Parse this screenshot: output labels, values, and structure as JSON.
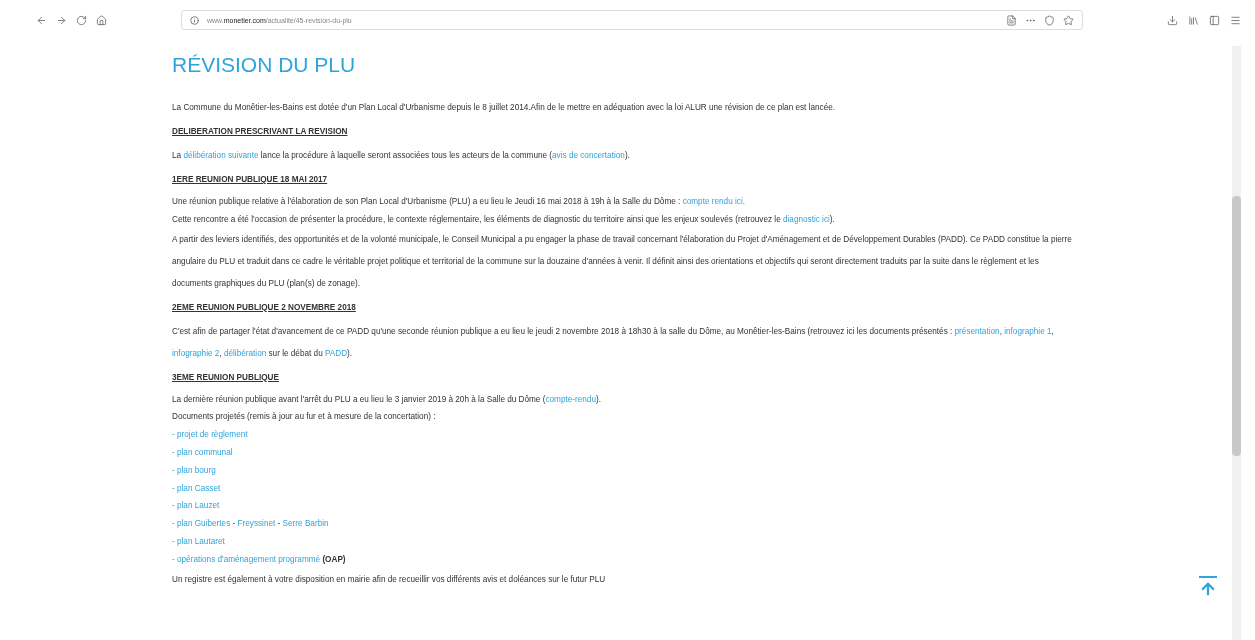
{
  "browser": {
    "url": "www.**monetier.com**/actualite/45-revision-du-plu"
  },
  "page": {
    "title": "RÉVISION DU PLU",
    "blocks": [
      {
        "kind": "paragraph",
        "segments": [
          {
            "text": "La Commune du Monêtier-les-Bains est dotée d'un Plan Local d'Urbanisme depuis le 8 juillet 2014.Afin de le mettre en adéquation avec la loi ALUR une révision de ce plan est lancée."
          }
        ]
      },
      {
        "kind": "heading",
        "segments": [
          {
            "text": "DELIBERATION PRESCRIVANT LA REVISION"
          }
        ]
      },
      {
        "kind": "paragraph",
        "segments": [
          {
            "text": " La "
          },
          {
            "link": "délibération suivante"
          },
          {
            "text": " lance la procédure à laquelle seront associées tous les acteurs de la commune ("
          },
          {
            "link": "avis de concertation"
          },
          {
            "text": ")."
          }
        ]
      },
      {
        "kind": "heading",
        "segments": [
          {
            "text": "1ERE REUNION PUBLIQUE 18 MAI 2017"
          }
        ]
      },
      {
        "kind": "line",
        "segments": [
          {
            "text": "Une réunion publique relative à l'élaboration de son Plan Local d'Urbanisme (PLU) a eu lieu le Jeudi 16 mai 2018 à 19h à la Salle du Dôme : "
          },
          {
            "link": "compte rendu ici."
          }
        ]
      },
      {
        "kind": "line",
        "segments": [
          {
            "text": "Cette rencontre a été l'occasion de présenter la procédure, le contexte réglementaire, les éléments de diagnostic du territoire ainsi que les enjeux soulevés (retrouvez le "
          },
          {
            "link": "diagnostic ici"
          },
          {
            "text": ")."
          }
        ]
      },
      {
        "kind": "paragraph",
        "segments": [
          {
            "text": "A partir des leviers identifiés, des opportunités et de la volonté municipale, le Conseil Municipal a pu engager la phase de travail concernant l'élaboration du Projet d'Aménagement et de Développement Durables (PADD). Ce PADD constitue la pierre angulaire du PLU et traduit dans ce cadre le véritable projet politique et territorial de la commune sur la douzaine d'années à venir. Il définit ainsi des orientations et objectifs qui seront directement traduits par la suite dans le règlement et les documents graphiques du PLU (plan(s) de zonage)."
          }
        ]
      },
      {
        "kind": "heading",
        "segments": [
          {
            "text": "2EME REUNION PUBLIQUE 2 NOVEMBRE 2018"
          }
        ]
      },
      {
        "kind": "paragraph",
        "segments": [
          {
            "text": "C'est afin de partager l'état d'avancement de ce PADD qu'une seconde réunion publique a eu lieu le jeudi 2 novembre 2018 à 18h30 à la salle du Dôme, au Monêtier-les-Bains (retrouvez ici les documents présentés : "
          },
          {
            "link": "présentation"
          },
          {
            "text": ", "
          },
          {
            "link": "infographie 1"
          },
          {
            "text": ", "
          },
          {
            "link": "infographie 2"
          },
          {
            "text": ", "
          },
          {
            "link": "délibération"
          },
          {
            "text": " sur le débat du "
          },
          {
            "link": "PADD"
          },
          {
            "text": ")."
          }
        ]
      },
      {
        "kind": "heading",
        "segments": [
          {
            "text": "3EME REUNION PUBLIQUE"
          }
        ]
      },
      {
        "kind": "line",
        "segments": [
          {
            "text": "La dernière réunion publique avant l'arrêt du PLU a eu lieu le 3 janvier 2019 à 20h à la Salle du Dôme ("
          },
          {
            "link": "compte-rendu"
          },
          {
            "text": ")."
          }
        ]
      },
      {
        "kind": "line",
        "segments": [
          {
            "text": "Documents projetés (remis à jour au fur et à mesure de la concertation) :"
          }
        ]
      },
      {
        "kind": "line",
        "segments": [
          {
            "link": "- projet de règlement"
          }
        ]
      },
      {
        "kind": "line",
        "segments": [
          {
            "link": "- plan communal"
          }
        ]
      },
      {
        "kind": "line",
        "segments": [
          {
            "link": "- plan bourg"
          }
        ]
      },
      {
        "kind": "line",
        "segments": [
          {
            "link": "- plan Casset"
          }
        ]
      },
      {
        "kind": "line",
        "segments": [
          {
            "link": "- plan Lauzet"
          }
        ]
      },
      {
        "kind": "line",
        "segments": [
          {
            "link": "- plan Guibertes"
          },
          {
            "text": " - "
          },
          {
            "link": "Freyssinet"
          },
          {
            "text": " - "
          },
          {
            "link": "Serre Barbin"
          }
        ]
      },
      {
        "kind": "line",
        "segments": [
          {
            "link": "- plan Lautaret"
          }
        ]
      },
      {
        "kind": "line",
        "segments": [
          {
            "link": "- opérations d'aménagement programmé"
          },
          {
            "text": " **(OAP)**"
          }
        ]
      },
      {
        "kind": "paragraph",
        "segments": [
          {
            "text": "Un registre est également à votre disposition en mairie afin de recueillir vos différents avis et doléances sur le futur PLU"
          }
        ]
      }
    ]
  }
}
